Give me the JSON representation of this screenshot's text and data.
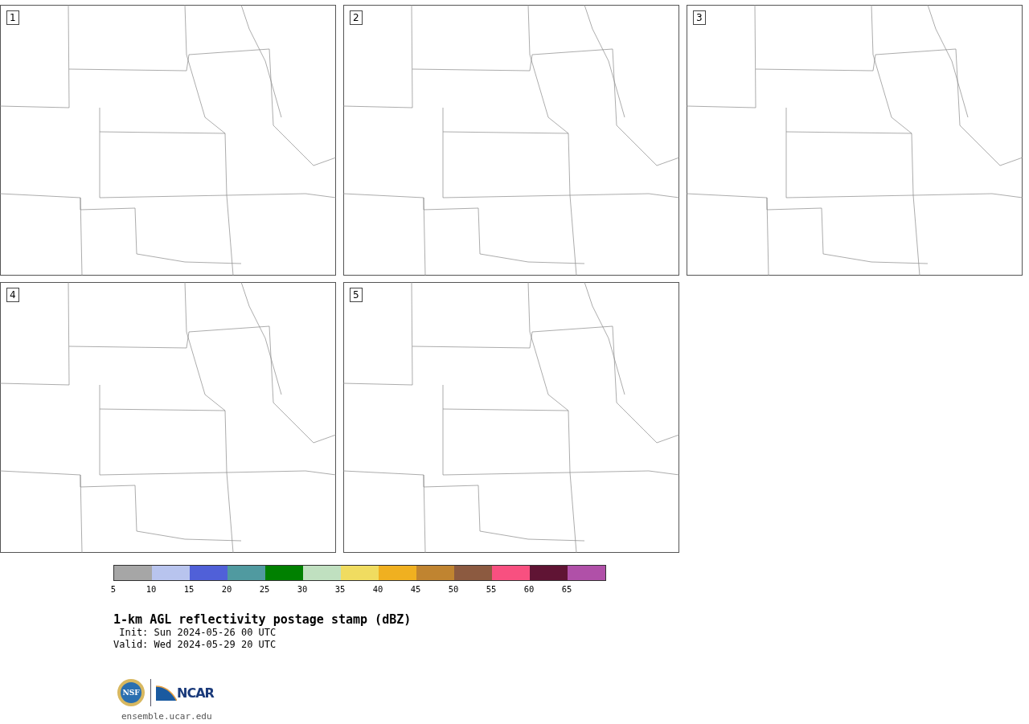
{
  "panels": [
    {
      "number": "1"
    },
    {
      "number": "2"
    },
    {
      "number": "3"
    },
    {
      "number": "4"
    },
    {
      "number": "5"
    }
  ],
  "colorbar": {
    "bins": [
      {
        "color": "#a6a6a6"
      },
      {
        "color": "#b8c4ee"
      },
      {
        "color": "#5060d8"
      },
      {
        "color": "#509aa0"
      },
      {
        "color": "#008000"
      },
      {
        "color": "#c0e0c0"
      },
      {
        "color": "#f0dc60"
      },
      {
        "color": "#f0b020"
      },
      {
        "color": "#c08430"
      },
      {
        "color": "#8c5a40"
      },
      {
        "color": "#f85080"
      },
      {
        "color": "#601434"
      },
      {
        "color": "#b050a8"
      }
    ],
    "ticks": [
      "5",
      "10",
      "15",
      "20",
      "25",
      "30",
      "35",
      "40",
      "45",
      "50",
      "55",
      "60",
      "65"
    ]
  },
  "title": "1-km AGL reflectivity postage stamp (dBZ)",
  "init": " Init: Sun 2024-05-26 00 UTC",
  "valid": "Valid: Wed 2024-05-29 20 UTC",
  "logos": {
    "nsf": "NSF",
    "ncar": "NCAR"
  },
  "url": "ensemble.ucar.edu"
}
